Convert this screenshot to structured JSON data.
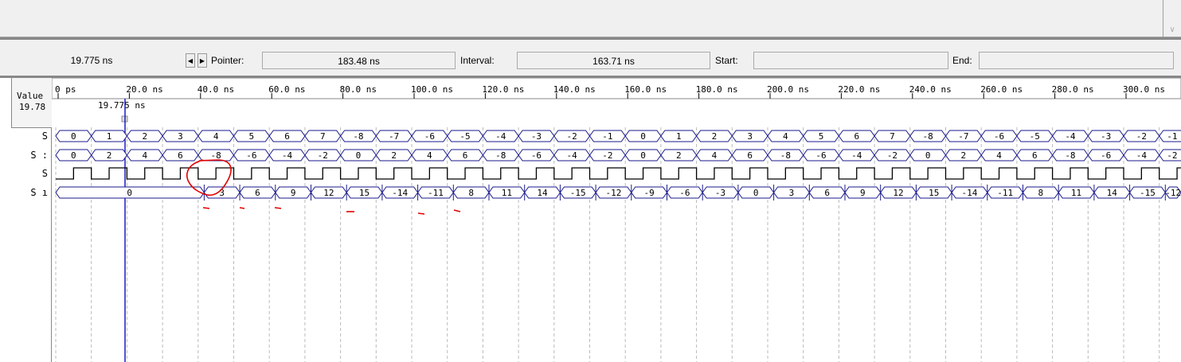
{
  "time_bar": {
    "cursor_time": "19.775 ns",
    "pointer_label": "Pointer:",
    "pointer_value": "183.48 ns",
    "interval_label": "Interval:",
    "interval_value": "163.71 ns",
    "start_label": "Start:",
    "start_value": "",
    "end_label": "End:",
    "end_value": ""
  },
  "columns": {
    "value_header": "Value",
    "cursor_value": "19.78"
  },
  "ruler": {
    "ticks": [
      "0 ps",
      "20.0 ns",
      "40.0 ns",
      "60.0 ns",
      "80.0 ns",
      "100.0 ns",
      "120.0 ns",
      "140.0 ns",
      "160.0 ns",
      "180.0 ns",
      "200.0 ns",
      "220.0 ns",
      "240.0 ns",
      "260.0 ns",
      "280.0 ns",
      "300.0 ns"
    ],
    "cursor_label": "19.775 ns"
  },
  "signals": [
    {
      "name": "S",
      "type": "bus",
      "values": [
        "0",
        "1",
        "2",
        "3",
        "4",
        "5",
        "6",
        "7",
        "-8",
        "-7",
        "-6",
        "-5",
        "-4",
        "-3",
        "-2",
        "-1",
        "0",
        "1",
        "2",
        "3",
        "4",
        "5",
        "6",
        "7",
        "-8",
        "-7",
        "-6",
        "-5",
        "-4",
        "-3",
        "-2",
        "-1"
      ]
    },
    {
      "name": "S :",
      "type": "bus",
      "values": [
        "0",
        "2",
        "4",
        "6",
        "-8",
        "-6",
        "-4",
        "-2",
        "0",
        "2",
        "4",
        "6",
        "-8",
        "-6",
        "-4",
        "-2",
        "0",
        "2",
        "4",
        "6",
        "-8",
        "-6",
        "-4",
        "-2",
        "0",
        "2",
        "4",
        "6",
        "-8",
        "-6",
        "-4",
        "-2"
      ]
    },
    {
      "name": "S",
      "type": "clock"
    },
    {
      "name": "S ı",
      "type": "bus",
      "first_value": "0",
      "values": [
        "3",
        "6",
        "9",
        "12",
        "15",
        "-14",
        "-11",
        "8",
        "11",
        "14",
        "-15",
        "-12",
        "-9",
        "-6",
        "-3",
        "0",
        "3",
        "6",
        "9",
        "12",
        "15",
        "-14",
        "-11",
        "8",
        "11",
        "14",
        "-15",
        "-12"
      ]
    }
  ],
  "colors": {
    "bus": "#1a1a8c",
    "cursor": "#1a1acc",
    "clock": "#000000",
    "annotation": "#e00000"
  }
}
